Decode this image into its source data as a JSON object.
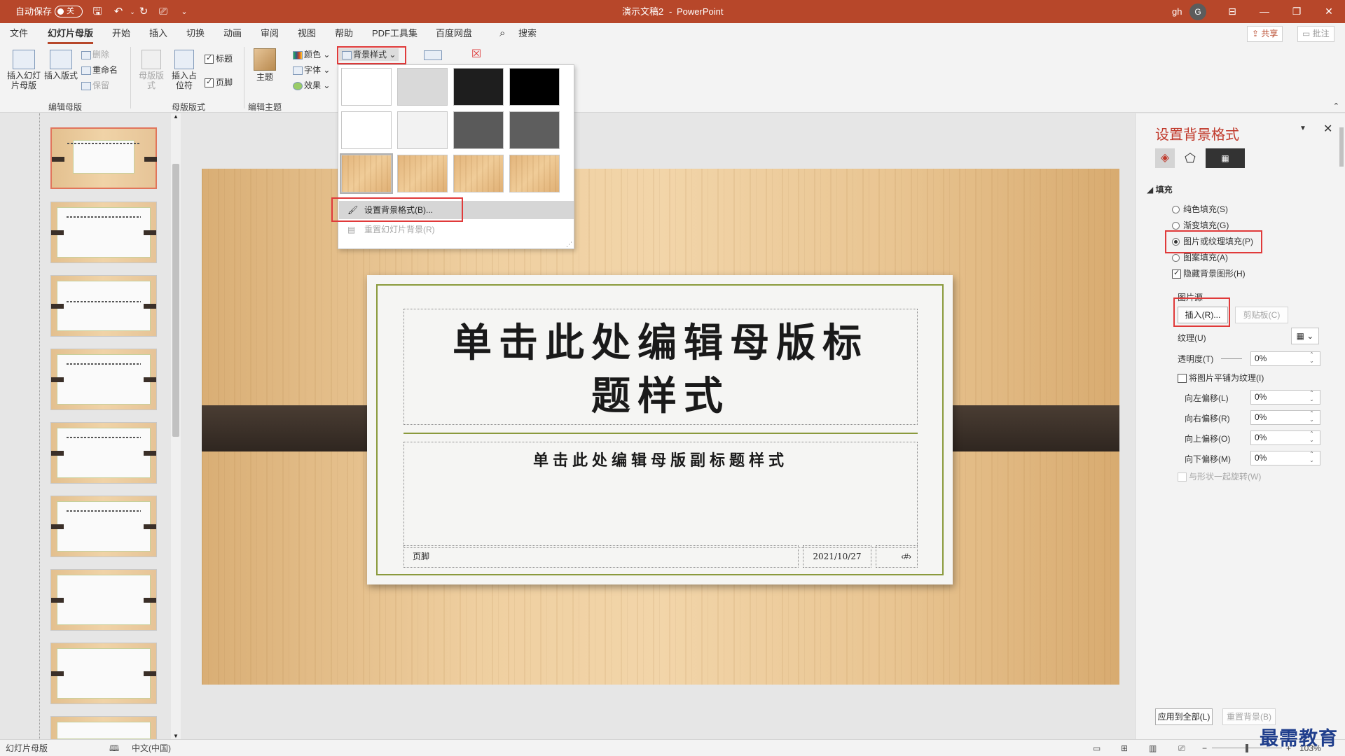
{
  "titlebar": {
    "autosave_label": "自动保存",
    "autosave_state": "关",
    "doc_title": "演示文稿2",
    "separator": "-",
    "app_name": "PowerPoint",
    "user_initials": "gh",
    "avatar_letter": "G",
    "accent_color": "#b7472a"
  },
  "tabs": [
    "文件",
    "幻灯片母版",
    "开始",
    "插入",
    "切换",
    "动画",
    "审阅",
    "视图",
    "帮助",
    "PDF工具集",
    "百度网盘"
  ],
  "search_label": "搜索",
  "share_label": "共享",
  "comments_label": "批注",
  "ribbon": {
    "insert_master": "插入幻灯片母版",
    "insert_layout": "插入版式",
    "delete": "删除",
    "rename": "重命名",
    "preserve": "保留",
    "group_edit_master": "编辑母版",
    "master_layout": "母版版式",
    "insert_placeholder": "插入占位符",
    "title_check": "标题",
    "footer_check": "页脚",
    "group_master_layout": "母版版式",
    "theme": "主题",
    "group_edit_theme": "编辑主题",
    "colors": "颜色",
    "fonts": "字体",
    "effects": "效果",
    "bg_styles": "背景样式"
  },
  "dropdown": {
    "swatches": [
      "#ffffff",
      "#d9d9d9",
      "#1e1e1e",
      "#000000",
      "#ffffff",
      "#f2f2f2",
      "#5a5a5a",
      "#5e5e5e",
      "wood",
      "wood",
      "wood",
      "wood"
    ],
    "format_bg": "设置背景格式(B)...",
    "reset_bg": "重置幻灯片背景(R)"
  },
  "slide": {
    "title_line1": "单击此处编辑母版标",
    "title_line2": "题样式",
    "subtitle": "单击此处编辑母版副标题样式",
    "footer": "页脚",
    "date": "2021/10/27",
    "page_num": "‹#›"
  },
  "format_pane": {
    "title": "设置背景格式",
    "section_fill": "填充",
    "solid_fill": "纯色填充(S)",
    "gradient_fill": "渐变填充(G)",
    "picture_fill": "图片或纹理填充(P)",
    "pattern_fill": "图案填充(A)",
    "hide_bg": "隐藏背景图形(H)",
    "picture_source": "图片源",
    "insert_btn": "插入(R)...",
    "clipboard_btn": "剪贴板(C)",
    "texture": "纹理(U)",
    "transparency": "透明度(T)",
    "transparency_val": "0%",
    "tile": "将图片平铺为纹理(I)",
    "offset_left": "向左偏移(L)",
    "offset_right": "向右偏移(R)",
    "offset_top": "向上偏移(O)",
    "offset_bottom": "向下偏移(M)",
    "offset_val": "0%",
    "rotate_with_shape": "与形状一起旋转(W)",
    "apply_all": "应用到全部(L)",
    "reset_bg": "重置背景(B)"
  },
  "statusbar": {
    "view_name": "幻灯片母版",
    "language": "中文(中国)",
    "zoom": "103%"
  },
  "watermark": "最需教育"
}
